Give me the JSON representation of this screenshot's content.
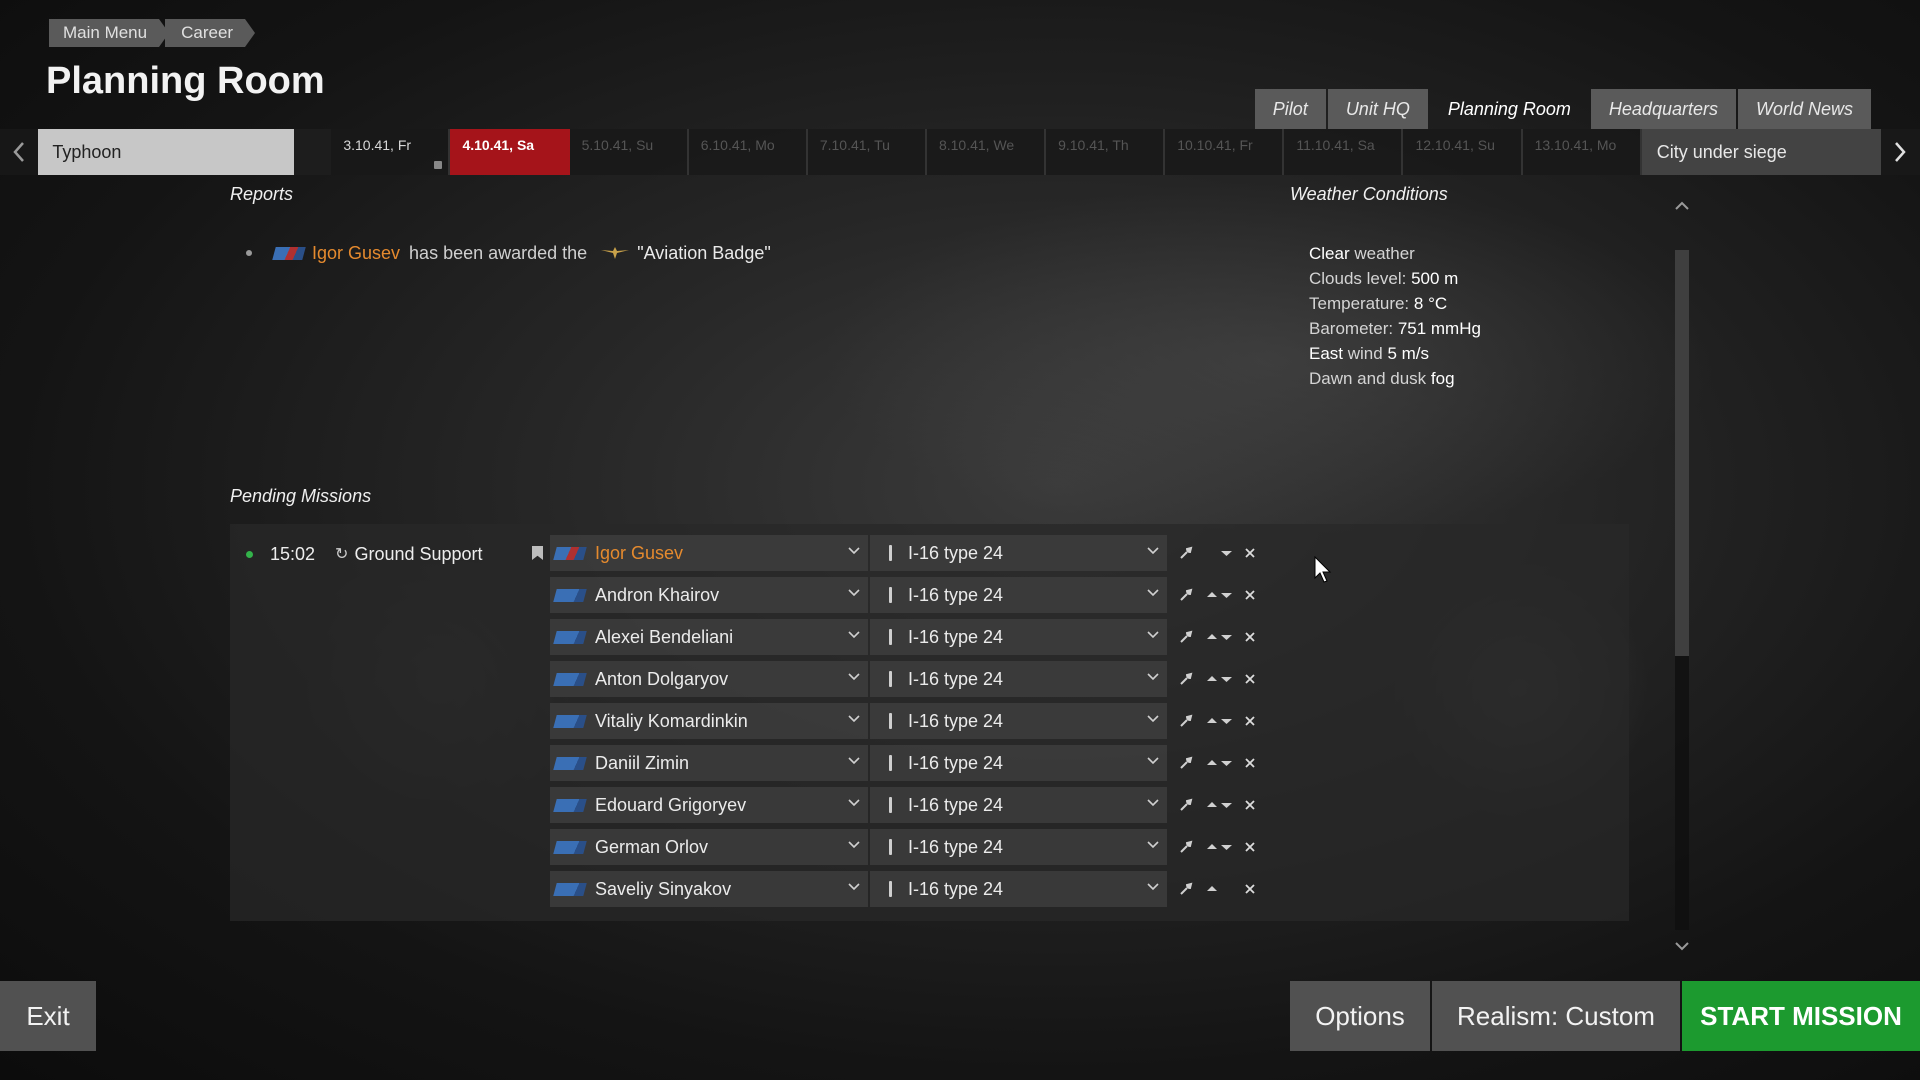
{
  "breadcrumb": {
    "main_menu": "Main Menu",
    "career": "Career"
  },
  "page_title": "Planning Room",
  "tabs": [
    {
      "label": "Pilot",
      "active": false
    },
    {
      "label": "Unit HQ",
      "active": false
    },
    {
      "label": "Planning Room",
      "active": true
    },
    {
      "label": "Headquarters",
      "active": false
    },
    {
      "label": "World News",
      "active": false
    }
  ],
  "datebar": {
    "campaign": "Typhoon",
    "mission": "City under siege",
    "days": [
      {
        "label": "3.10.41, Fr",
        "state": "past"
      },
      {
        "label": "4.10.41, Sa",
        "state": "current"
      },
      {
        "label": "5.10.41, Su",
        "state": "future"
      },
      {
        "label": "6.10.41, Mo",
        "state": "future"
      },
      {
        "label": "7.10.41, Tu",
        "state": "future"
      },
      {
        "label": "8.10.41, We",
        "state": "future"
      },
      {
        "label": "9.10.41, Th",
        "state": "future"
      },
      {
        "label": "10.10.41, Fr",
        "state": "future"
      },
      {
        "label": "11.10.41, Sa",
        "state": "future"
      },
      {
        "label": "12.10.41, Su",
        "state": "future"
      },
      {
        "label": "13.10.41, Mo",
        "state": "future"
      }
    ]
  },
  "reports": {
    "title": "Reports",
    "items": [
      {
        "pilot": "Igor Gusev",
        "text": "has been awarded the",
        "award": "\"Aviation Badge\""
      }
    ]
  },
  "weather": {
    "title": "Weather Conditions",
    "clear": "Clear",
    "weather_word": " weather",
    "clouds_label": "Clouds level: ",
    "clouds_value": "500 m",
    "temp_label": "Temperature: ",
    "temp_value": "8 °C",
    "baro_label": "Barometer: ",
    "baro_value": "751 mmHg",
    "wind_dir": "East",
    "wind_label": " wind ",
    "wind_value": "5 m/s",
    "fog_label": "Dawn and dusk ",
    "fog_value": "fog"
  },
  "pending": {
    "title": "Pending Missions",
    "mission": {
      "time": "15:02",
      "type": "Ground Support"
    },
    "pilots": [
      {
        "name": "Igor Gusev",
        "plane": "I-16 type 24"
      },
      {
        "name": "Andron Khairov",
        "plane": "I-16 type 24"
      },
      {
        "name": "Alexei Bendeliani",
        "plane": "I-16 type 24"
      },
      {
        "name": "Anton Dolgaryov",
        "plane": "I-16 type 24"
      },
      {
        "name": "Vitaliy Komardinkin",
        "plane": "I-16 type 24"
      },
      {
        "name": "Daniil Zimin",
        "plane": "I-16 type 24"
      },
      {
        "name": "Edouard Grigoryev",
        "plane": "I-16 type 24"
      },
      {
        "name": "German Orlov",
        "plane": "I-16 type 24"
      },
      {
        "name": "Saveliy Sinyakov",
        "plane": "I-16 type 24"
      }
    ]
  },
  "buttons": {
    "exit": "Exit",
    "options": "Options",
    "realism": "Realism: Custom",
    "start": "START MISSION"
  },
  "colors": {
    "accent_red": "#a5141a",
    "start_green": "#1c9a2f",
    "pilot_orange": "#e58a2e"
  }
}
